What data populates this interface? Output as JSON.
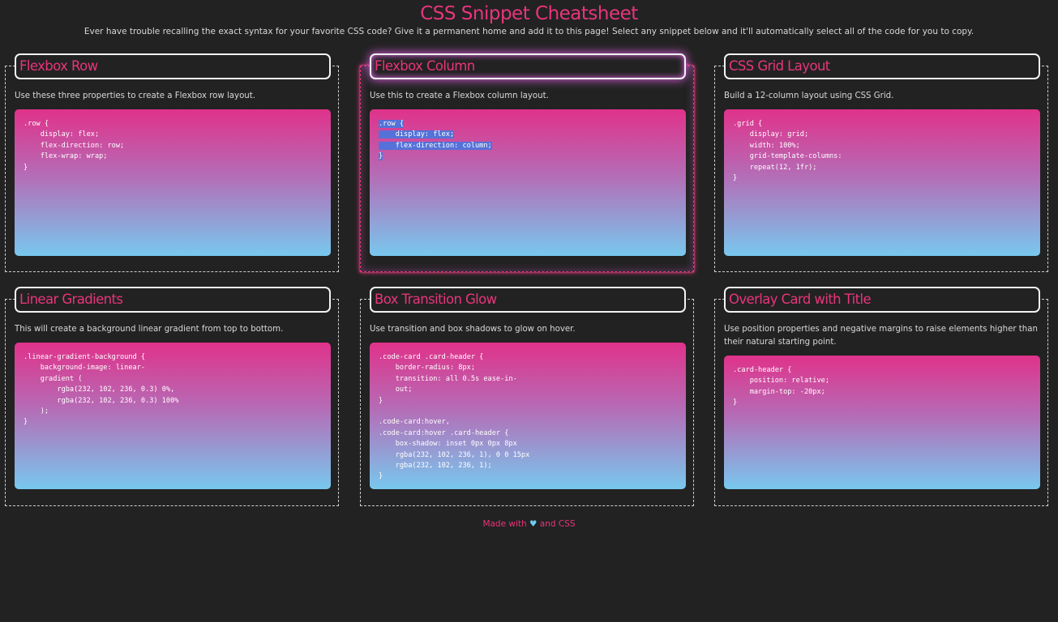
{
  "page": {
    "title": "CSS Snippet Cheatsheet",
    "subtitle": "Ever have trouble recalling the exact syntax for your favorite CSS code? Give it a permanent home and add it to this page! Select any snippet below and it'll automatically select all of the code for you to copy."
  },
  "cards": [
    {
      "title": "Flexbox Row",
      "description": "Use these three properties to create a Flexbox row layout.",
      "code": [
        ".row {",
        "    display: flex;",
        "    flex-direction: row;",
        "    flex-wrap: wrap;",
        "}"
      ]
    },
    {
      "title": "Flexbox Column",
      "description": "Use this to create a Flexbox column layout.",
      "code": [
        ".row {",
        "    display: flex;",
        "    flex-direction: column;",
        "}"
      ]
    },
    {
      "title": "CSS Grid Layout",
      "description": "Build a 12-column layout using CSS Grid.",
      "code": [
        ".grid {",
        "    display: grid;",
        "    width: 100%;",
        "    grid-template-columns:",
        "    repeat(12, 1fr);",
        "}"
      ]
    },
    {
      "title": "Linear Gradients",
      "description": "This will create a background linear gradient from top to bottom.",
      "code": [
        ".linear-gradient-background {",
        "    background-image: linear-",
        "    gradient (",
        "        rgba(232, 102, 236, 0.3) 0%,",
        "        rgba(232, 102, 236, 0.3) 100%",
        "    );",
        "}"
      ]
    },
    {
      "title": "Box Transition Glow",
      "description": "Use transition and box shadows to glow on hover.",
      "code": [
        ".code-card .card-header {",
        "    border-radius: 8px;",
        "    transition: all 0.5s ease-in-",
        "    out;",
        "}",
        "",
        ".code-card:hover,",
        ".code-card:hover .card-header {",
        "    box-shadow: inset 0px 0px 8px",
        "    rgba(232, 102, 236, 1), 0 0 15px",
        "    rgba(232, 102, 236, 1);",
        "}"
      ]
    },
    {
      "title": "Overlay Card with Title",
      "description": "Use position properties and negative margins to raise elements higher than their natural starting point.",
      "code": [
        ".card-header {",
        "    position: relative;",
        "    margin-top: -20px;",
        "}"
      ]
    }
  ],
  "footer": {
    "made_with": "Made with",
    "heart": "♥",
    "and_css": "and CSS"
  },
  "colors": {
    "background": "#222222",
    "accent_pink": "#e8357a",
    "gradient_top": "#e0328a",
    "gradient_bottom": "#78c8ee",
    "selection": "#5472d8",
    "heart": "#6fc9ef"
  },
  "state": {
    "hovered_card": "Flexbox Column",
    "selected_snippet": "Flexbox Column"
  }
}
